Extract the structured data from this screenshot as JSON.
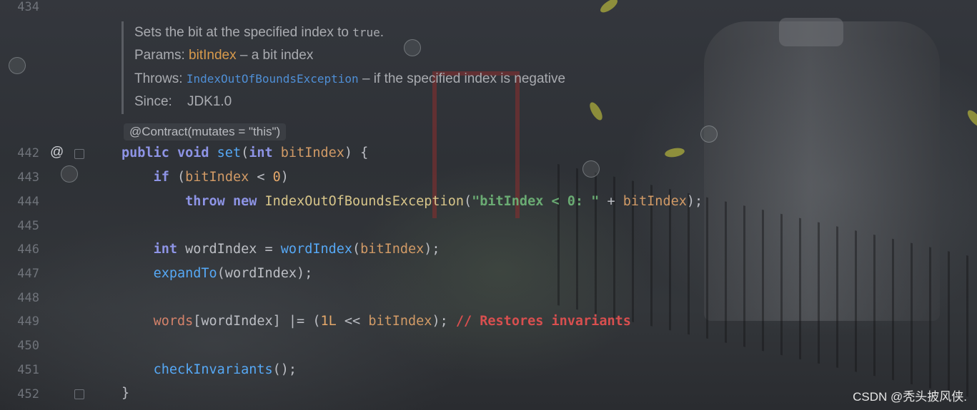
{
  "editor": {
    "top_line_number": "434",
    "line_numbers": [
      "442",
      "443",
      "444",
      "445",
      "446",
      "447",
      "448",
      "449",
      "450",
      "451",
      "452"
    ],
    "gutter_marker": "@"
  },
  "javadoc": {
    "description_text": "Sets the bit at the specified index to ",
    "description_code": "true",
    "description_end": ".",
    "params_label": "Params:",
    "param_name": "bitIndex",
    "param_desc": " – a bit index",
    "throws_label": "Throws:",
    "throws_link": "IndexOutOfBoundsException",
    "throws_desc": " – if the specified index is negative",
    "since_label": "Since:",
    "since_value": "JDK1.0"
  },
  "annotation_hint": "@Contract(mutates = \"this\")",
  "code": {
    "l442": {
      "public": "public",
      "void": "void",
      "name": "set",
      "open": "(",
      "type": "int",
      "param": "bitIndex",
      "close": ") {"
    },
    "l443": {
      "if": "if",
      "open": " (",
      "var": "bitIndex",
      "op": " < ",
      "num": "0",
      "close": ")"
    },
    "l444": {
      "throw": "throw",
      "new": "new",
      "cls": "IndexOutOfBoundsException",
      "open": "(",
      "str": "\"bitIndex < 0: \"",
      "plus": " + ",
      "var": "bitIndex",
      "close": ");"
    },
    "l446": {
      "type": "int",
      "decl": " wordIndex = ",
      "fn": "wordIndex",
      "open": "(",
      "arg": "bitIndex",
      "close": ");"
    },
    "l447": {
      "fn": "expandTo",
      "args": "(wordIndex);"
    },
    "l449": {
      "field": "words",
      "mid": "[wordIndex] |= (",
      "num": "1L",
      "op": " << ",
      "var": "bitIndex",
      "close": "); ",
      "comment": "// Restores invariants"
    },
    "l451": {
      "fn": "checkInvariants",
      "args": "();"
    },
    "l452": {
      "brace": "}"
    }
  },
  "watermark": "CSDN @秃头披风侠."
}
